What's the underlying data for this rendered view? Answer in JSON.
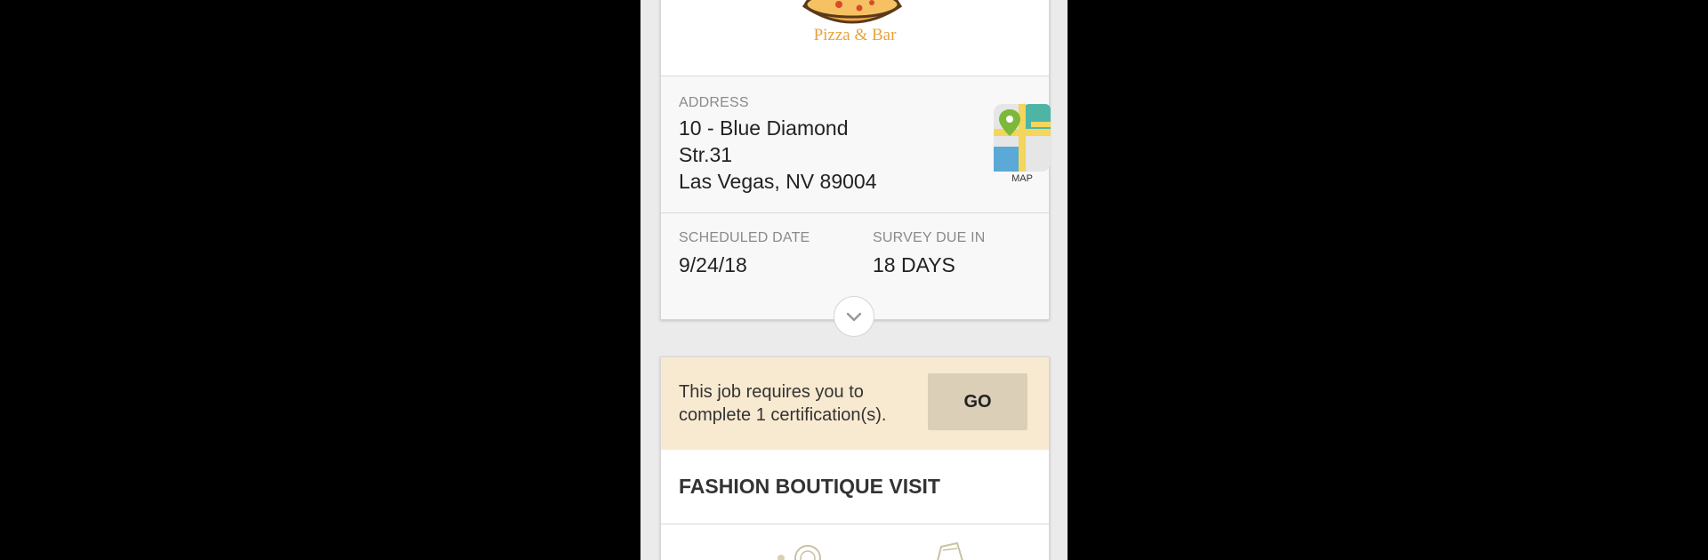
{
  "brand": {
    "tagline": "Pizza & Bar"
  },
  "address": {
    "label": "ADDRESS",
    "line1": "10 - Blue Diamond",
    "line2": "Str.31",
    "line3": "Las Vegas, NV 89004",
    "map_label": "MAP"
  },
  "schedule": {
    "date_label": "SCHEDULED DATE",
    "date_value": "9/24/18",
    "due_label": "SURVEY DUE IN",
    "due_value": "18 DAYS"
  },
  "certification": {
    "message": "This job requires you to complete 1 certification(s).",
    "go_label": "GO"
  },
  "job": {
    "title": "FASHION BOUTIQUE VISIT"
  },
  "colors": {
    "brand_accent": "#e8a33a",
    "banner_bg": "#f8ead0",
    "go_button_bg": "#dccfb8"
  }
}
